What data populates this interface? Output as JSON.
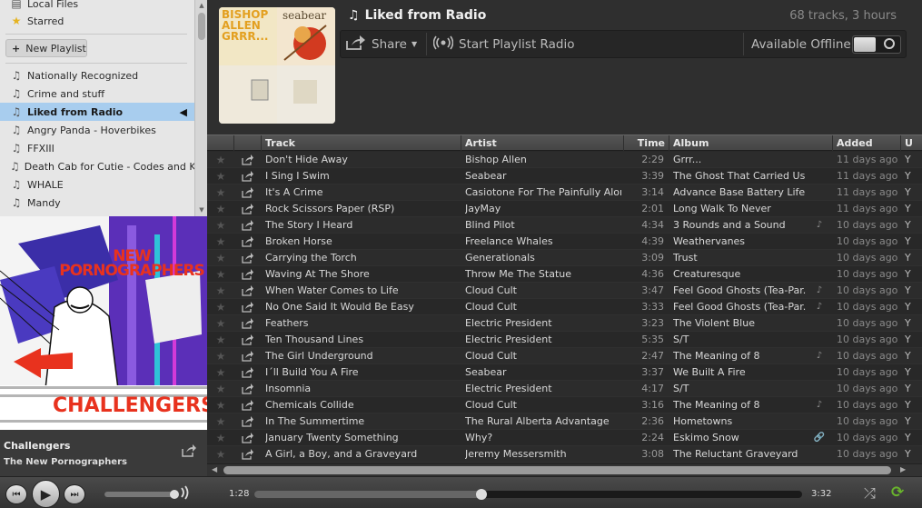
{
  "colors": {
    "accent_green": "#69b42c",
    "selection_blue": "#a8cdee",
    "star_yellow": "#e5b320"
  },
  "sidebar": {
    "top_items": [
      {
        "label": "Local Files",
        "icon": "file-icon"
      },
      {
        "label": "Starred",
        "icon": "star-icon"
      }
    ],
    "new_playlist_label": "New Playlist",
    "playlists": [
      {
        "label": "Nationally Recognized"
      },
      {
        "label": "Crime and stuff"
      },
      {
        "label": "Liked from Radio",
        "active": true
      },
      {
        "label": "Angry Panda - Hoverbikes"
      },
      {
        "label": "FFXIII"
      },
      {
        "label": "Death Cab for Cutie - Codes and K..."
      },
      {
        "label": "WHALE"
      },
      {
        "label": "Mandy"
      }
    ]
  },
  "now_playing": {
    "cover_text_top": "NEW PORNOGRAPHERS",
    "cover_text_bottom": "CHALLENGERS",
    "title": "Challengers",
    "artist": "The New Pornographers"
  },
  "header": {
    "title": "Liked from Radio",
    "stats": "68 tracks, 3 hours",
    "share_label": "Share",
    "radio_label": "Start Playlist Radio",
    "offline_label": "Available Offline",
    "cover_texts": {
      "tl": "BISHOP ALLEN GRRR...",
      "tr": "seabear"
    }
  },
  "table": {
    "columns": {
      "track": "Track",
      "artist": "Artist",
      "time": "Time",
      "album": "Album",
      "added": "Added",
      "user": "U"
    },
    "rows": [
      {
        "track": "Don't Hide Away",
        "artist": "Bishop Allen",
        "time": "2:29",
        "album": "Grrr...",
        "added": "11 days ago",
        "flag": "",
        "user": "Y"
      },
      {
        "track": "I Sing I Swim",
        "artist": "Seabear",
        "time": "3:39",
        "album": "The Ghost That Carried Us ...",
        "added": "11 days ago",
        "flag": "",
        "user": "Y"
      },
      {
        "track": "It's A Crime",
        "artist": "Casiotone For The Painfully Alone",
        "time": "3:14",
        "album": "Advance Base Battery Life",
        "added": "11 days ago",
        "flag": "",
        "user": "Y"
      },
      {
        "track": "Rock Scissors Paper (RSP)",
        "artist": "JayMay",
        "time": "2:01",
        "album": "Long Walk To Never",
        "added": "11 days ago",
        "flag": "",
        "user": "Y"
      },
      {
        "track": "The Story I Heard",
        "artist": "Blind Pilot",
        "time": "4:34",
        "album": "3 Rounds and a Sound",
        "added": "10 days ago",
        "flag": "♪",
        "user": "Y"
      },
      {
        "track": "Broken Horse",
        "artist": "Freelance Whales",
        "time": "4:39",
        "album": "Weathervanes",
        "added": "10 days ago",
        "flag": "",
        "user": "Y"
      },
      {
        "track": "Carrying the Torch",
        "artist": "Generationals",
        "time": "3:09",
        "album": "Trust",
        "added": "10 days ago",
        "flag": "",
        "user": "Y"
      },
      {
        "track": "Waving At The Shore",
        "artist": "Throw Me The Statue",
        "time": "4:36",
        "album": "Creaturesque",
        "added": "10 days ago",
        "flag": "",
        "user": "Y"
      },
      {
        "track": "When Water Comes to Life",
        "artist": "Cloud Cult",
        "time": "3:47",
        "album": "Feel Good Ghosts (Tea-Par...",
        "added": "10 days ago",
        "flag": "♪",
        "user": "Y"
      },
      {
        "track": "No One Said It Would Be Easy",
        "artist": "Cloud Cult",
        "time": "3:33",
        "album": "Feel Good Ghosts (Tea-Par...",
        "added": "10 days ago",
        "flag": "♪",
        "user": "Y"
      },
      {
        "track": "Feathers",
        "artist": "Electric President",
        "time": "3:23",
        "album": "The Violent Blue",
        "added": "10 days ago",
        "flag": "",
        "user": "Y"
      },
      {
        "track": "Ten Thousand Lines",
        "artist": "Electric President",
        "time": "5:35",
        "album": "S/T",
        "added": "10 days ago",
        "flag": "",
        "user": "Y"
      },
      {
        "track": "The Girl Underground",
        "artist": "Cloud Cult",
        "time": "2:47",
        "album": "The Meaning of 8",
        "added": "10 days ago",
        "flag": "♪",
        "user": "Y"
      },
      {
        "track": "I´ll Build You A Fire",
        "artist": "Seabear",
        "time": "3:37",
        "album": "We Built A Fire",
        "added": "10 days ago",
        "flag": "",
        "user": "Y"
      },
      {
        "track": "Insomnia",
        "artist": "Electric President",
        "time": "4:17",
        "album": "S/T",
        "added": "10 days ago",
        "flag": "",
        "user": "Y"
      },
      {
        "track": "Chemicals Collide",
        "artist": "Cloud Cult",
        "time": "3:16",
        "album": "The Meaning of 8",
        "added": "10 days ago",
        "flag": "♪",
        "user": "Y"
      },
      {
        "track": "In The Summertime",
        "artist": "The Rural Alberta Advantage",
        "time": "2:36",
        "album": "Hometowns",
        "added": "10 days ago",
        "flag": "",
        "user": "Y"
      },
      {
        "track": "January Twenty Something",
        "artist": "Why?",
        "time": "2:24",
        "album": "Eskimo Snow",
        "added": "10 days ago",
        "flag": "🔗",
        "user": "Y"
      },
      {
        "track": "A Girl, a Boy, and a Graveyard",
        "artist": "Jeremy Messersmith",
        "time": "3:08",
        "album": "The Reluctant Graveyard",
        "added": "10 days ago",
        "flag": "",
        "user": "Y"
      }
    ]
  },
  "player": {
    "elapsed": "1:28",
    "total": "3:32",
    "progress": 0.415,
    "volume": 0.95
  }
}
